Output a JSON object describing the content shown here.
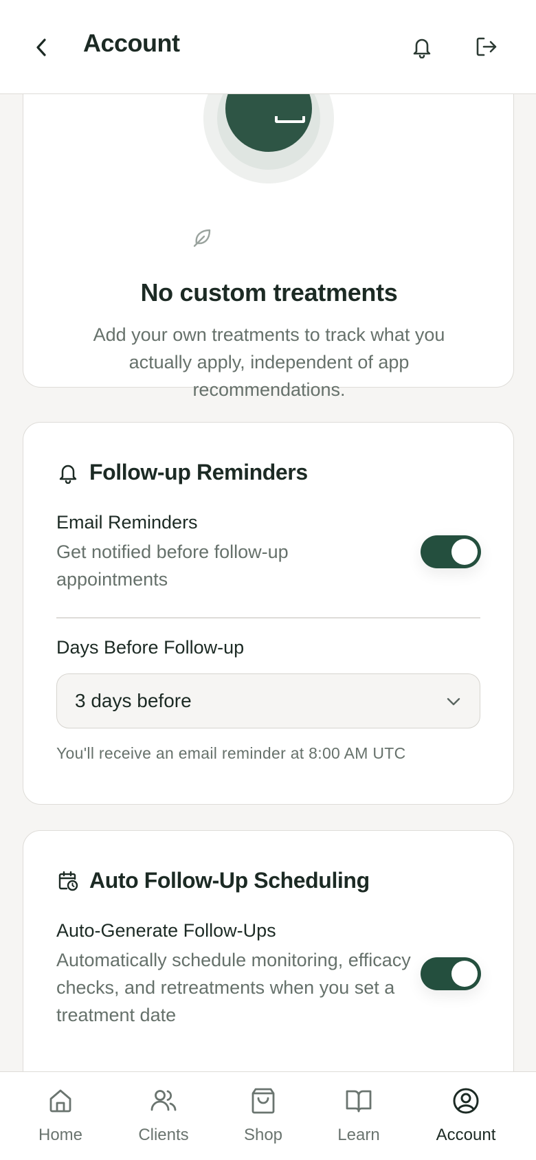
{
  "header": {
    "title": "Account",
    "back_icon": "chevron-left-icon",
    "notifications_icon": "bell-icon",
    "logout_icon": "logout-icon"
  },
  "custom_treatments": {
    "empty_title": "No custom treatments",
    "empty_description": "Add your own treatments to track what you actually apply, independent of app recommendations."
  },
  "follow_up_reminders": {
    "section_title": "Follow-up Reminders",
    "email_reminders_label": "Email Reminders",
    "email_reminders_description": "Get notified before follow-up appointments",
    "email_reminders_enabled": true,
    "days_before_label": "Days Before Follow-up",
    "days_before_value": "3 days before",
    "hint": "You'll receive an email reminder at 8:00 AM UTC"
  },
  "auto_follow_up": {
    "section_title": "Auto Follow-Up Scheduling",
    "auto_generate_label": "Auto-Generate Follow-Ups",
    "auto_generate_description": "Automatically schedule monitoring, efficacy checks, and retreatments when you set a treatment date",
    "auto_generate_enabled": true
  },
  "tabbar": {
    "items": [
      {
        "label": "Home",
        "icon": "home-icon"
      },
      {
        "label": "Clients",
        "icon": "users-icon"
      },
      {
        "label": "Shop",
        "icon": "shopping-bag-icon"
      },
      {
        "label": "Learn",
        "icon": "book-open-icon"
      },
      {
        "label": "Account",
        "icon": "user-circle-icon",
        "active": true
      }
    ]
  },
  "colors": {
    "accent": "#244f3e",
    "background": "#f6f5f3",
    "card": "#ffffff",
    "text_primary": "#1c2a24",
    "text_secondary": "#66716b"
  }
}
